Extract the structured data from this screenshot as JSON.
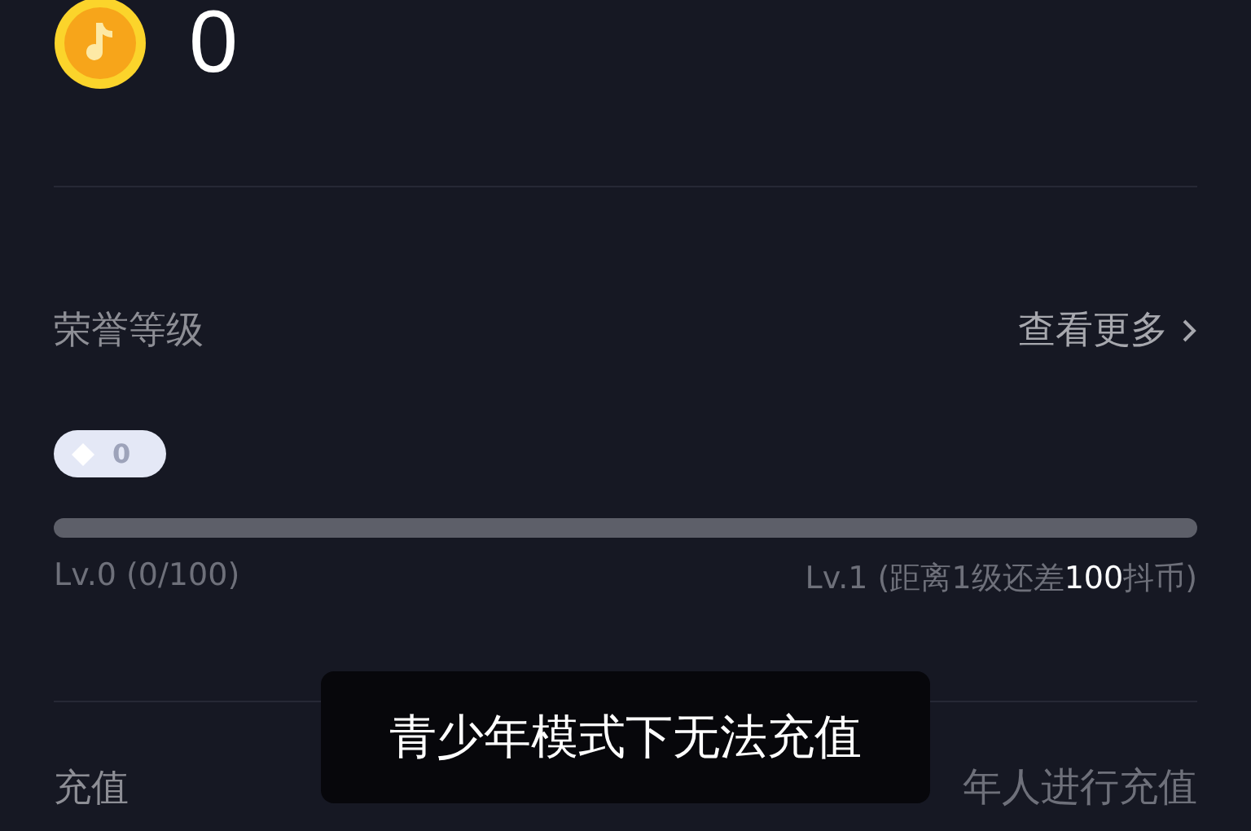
{
  "balance": {
    "amount": "0"
  },
  "honor": {
    "title": "荣誉等级",
    "more": "查看更多",
    "badge": "0",
    "level": 0,
    "current": "Lv.0 (0/100)",
    "next": "Lv.1 (距离1级还差**100**抖币)"
  },
  "recharge": {
    "title": "充值",
    "note": "年人进行充值"
  },
  "toast": {
    "message": "青少年模式下无法充值"
  }
}
